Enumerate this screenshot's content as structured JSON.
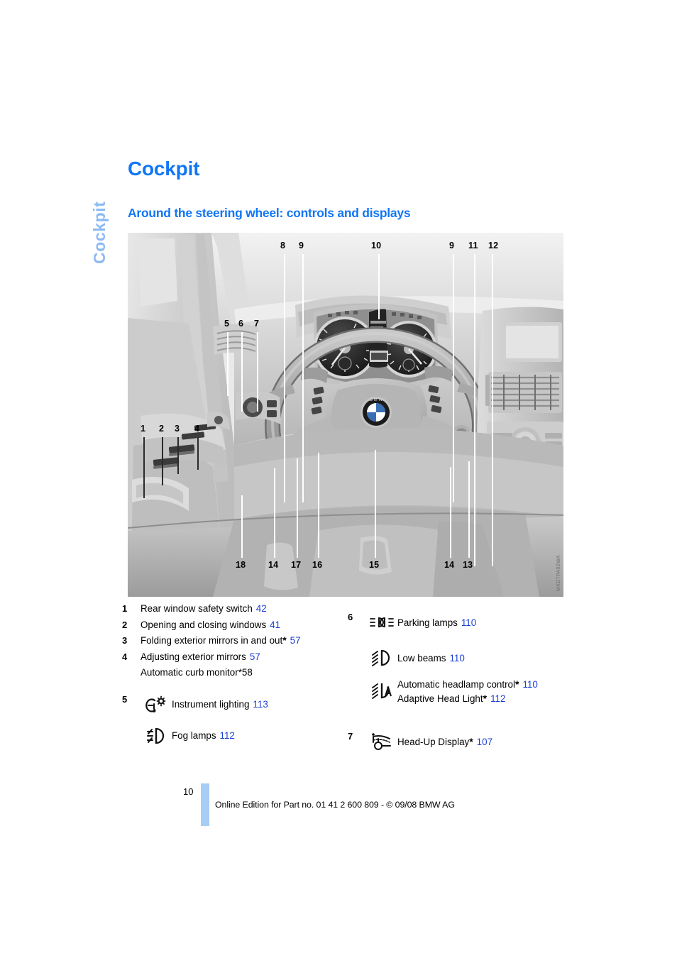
{
  "chapter_tab": {
    "label": "Cockpit"
  },
  "headings": {
    "chapter_title": "Cockpit",
    "section_title": "Around the steering wheel: controls and displays"
  },
  "colors": {
    "heading_blue": "#1176f5",
    "tab_blue": "#8cbaf2",
    "page_ref_blue": "#1a3fd6",
    "page_bar_blue": "#a8cdf5"
  },
  "figure": {
    "alt": "BMW cockpit: driver door controls, steering wheel, instrument cluster and center console",
    "code": "MXD7PA02WA",
    "callouts_top_left": [
      "5",
      "6",
      "7"
    ],
    "callouts_top": [
      "8",
      "9",
      "10",
      "9",
      "11",
      "12"
    ],
    "callouts_left": [
      "1",
      "2",
      "3",
      "4"
    ],
    "callouts_bottom": [
      "18",
      "14",
      "17",
      "16",
      "15",
      "14",
      "13"
    ]
  },
  "legend": {
    "left": [
      {
        "num": "1",
        "text": "Rear window safety switch",
        "page": "42"
      },
      {
        "num": "2",
        "text": "Opening and closing windows",
        "page": "41"
      },
      {
        "num": "3",
        "text": "Folding exterior mirrors in and out",
        "star": true,
        "page": "57"
      },
      {
        "num": "4",
        "text": "Adjusting exterior mirrors",
        "page": "57",
        "sub": {
          "text": "Automatic curb monitor",
          "star": true,
          "page": "58"
        }
      }
    ],
    "left_icons": {
      "num": "5",
      "items": [
        {
          "icon": "instrument-lighting-icon",
          "text": "Instrument lighting",
          "page": "113"
        },
        {
          "icon": "fog-lamps-icon",
          "text": "Fog lamps",
          "page": "112"
        }
      ]
    },
    "right_icons_6": {
      "num": "6",
      "items": [
        {
          "icon": "parking-lamps-icon",
          "text": "Parking lamps",
          "page": "110"
        },
        {
          "icon": "low-beams-icon",
          "text": "Low beams",
          "page": "110"
        },
        {
          "icon": "automatic-headlamp-control-icon",
          "text": "Automatic headlamp control",
          "star": true,
          "page": "110",
          "sub": {
            "text": "Adaptive Head Light",
            "star": true,
            "page": "112"
          }
        }
      ]
    },
    "right_icons_7": {
      "num": "7",
      "items": [
        {
          "icon": "head-up-display-icon",
          "text": "Head-Up Display",
          "star": true,
          "page": "107"
        }
      ]
    }
  },
  "footer": {
    "page_number": "10",
    "text": "Online Edition for Part no. 01 41 2 600 809 - © 09/08 BMW AG"
  }
}
